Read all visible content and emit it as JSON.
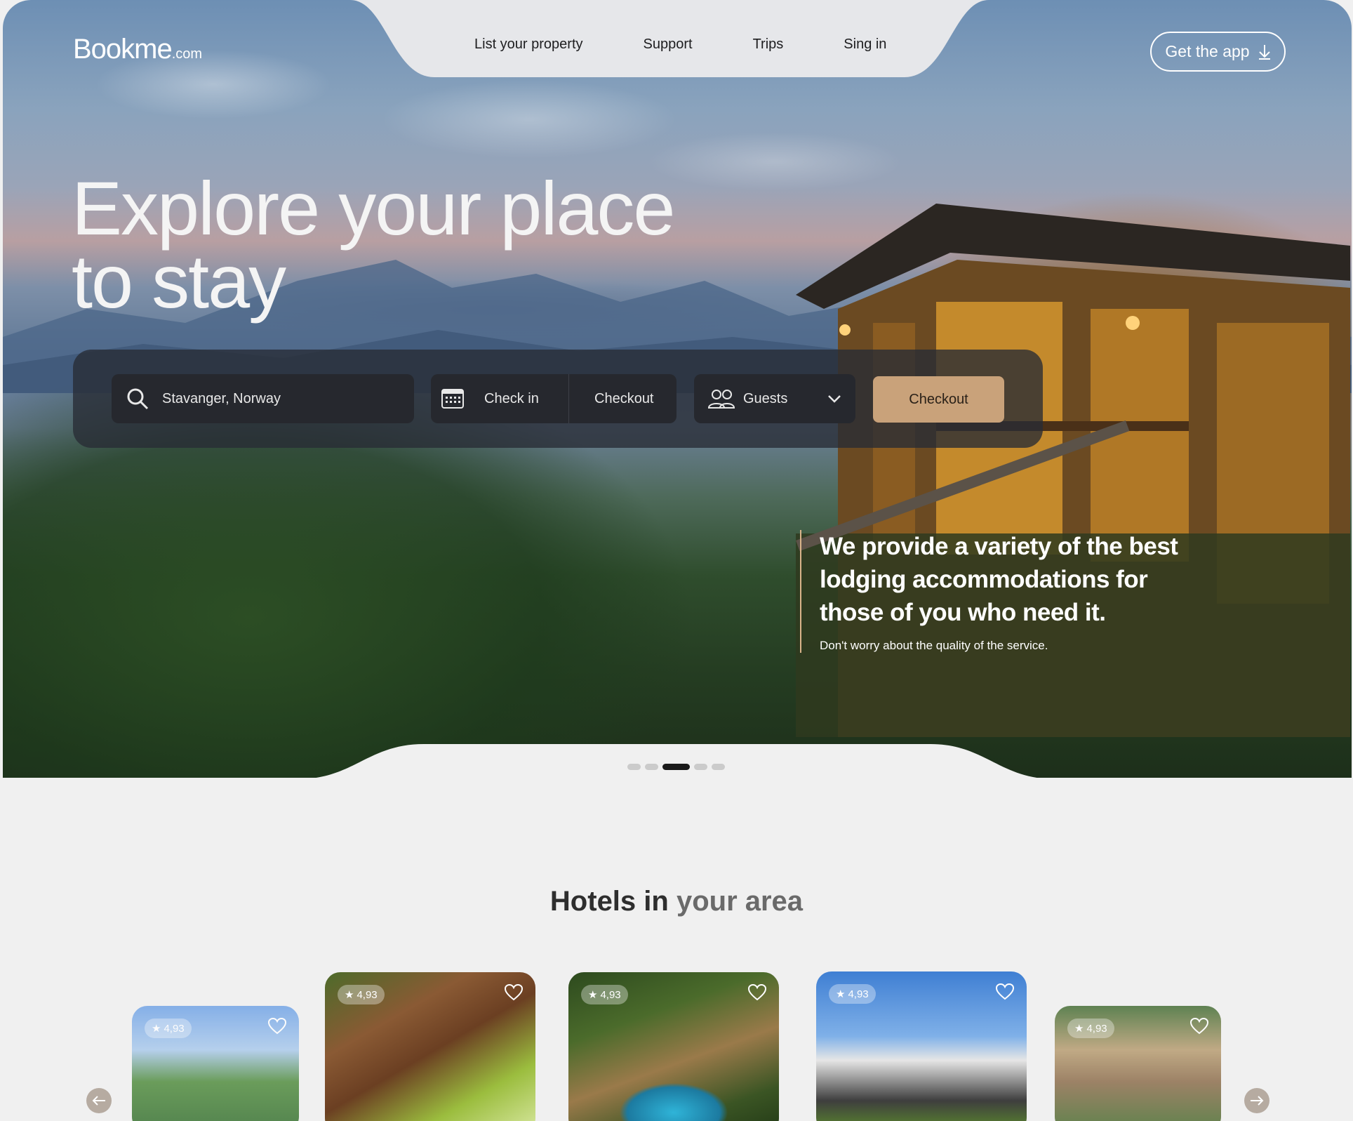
{
  "brand": {
    "name": "Bookme",
    "suffix": ".com"
  },
  "nav": {
    "links": [
      "List your property",
      "Support",
      "Trips",
      "Sing in"
    ],
    "get_app": "Get the app"
  },
  "hero": {
    "headline_line1": "Explore your place",
    "headline_line2": "to stay",
    "tagline": "We provide a variety of the best lodging accommodations for those of you who need it.",
    "subtext": "Don't worry about the quality of the service.",
    "slider": {
      "count": 5,
      "active": 3
    }
  },
  "search": {
    "location": "Stavanger, Norway",
    "check_in": "Check in",
    "checkout": "Checkout",
    "guests": "Guests",
    "button": "Checkout"
  },
  "hotels": {
    "title_dark": "Hotels in",
    "title_muted": "your area",
    "cards": [
      {
        "rating": "4,93"
      },
      {
        "rating": "4,93"
      },
      {
        "rating": "4,93"
      },
      {
        "rating": "4,93"
      },
      {
        "rating": "4,93"
      }
    ]
  },
  "colors": {
    "accent": "#c9a27a",
    "search_bg": "#26282e",
    "page_bg": "#f0f0f0"
  }
}
